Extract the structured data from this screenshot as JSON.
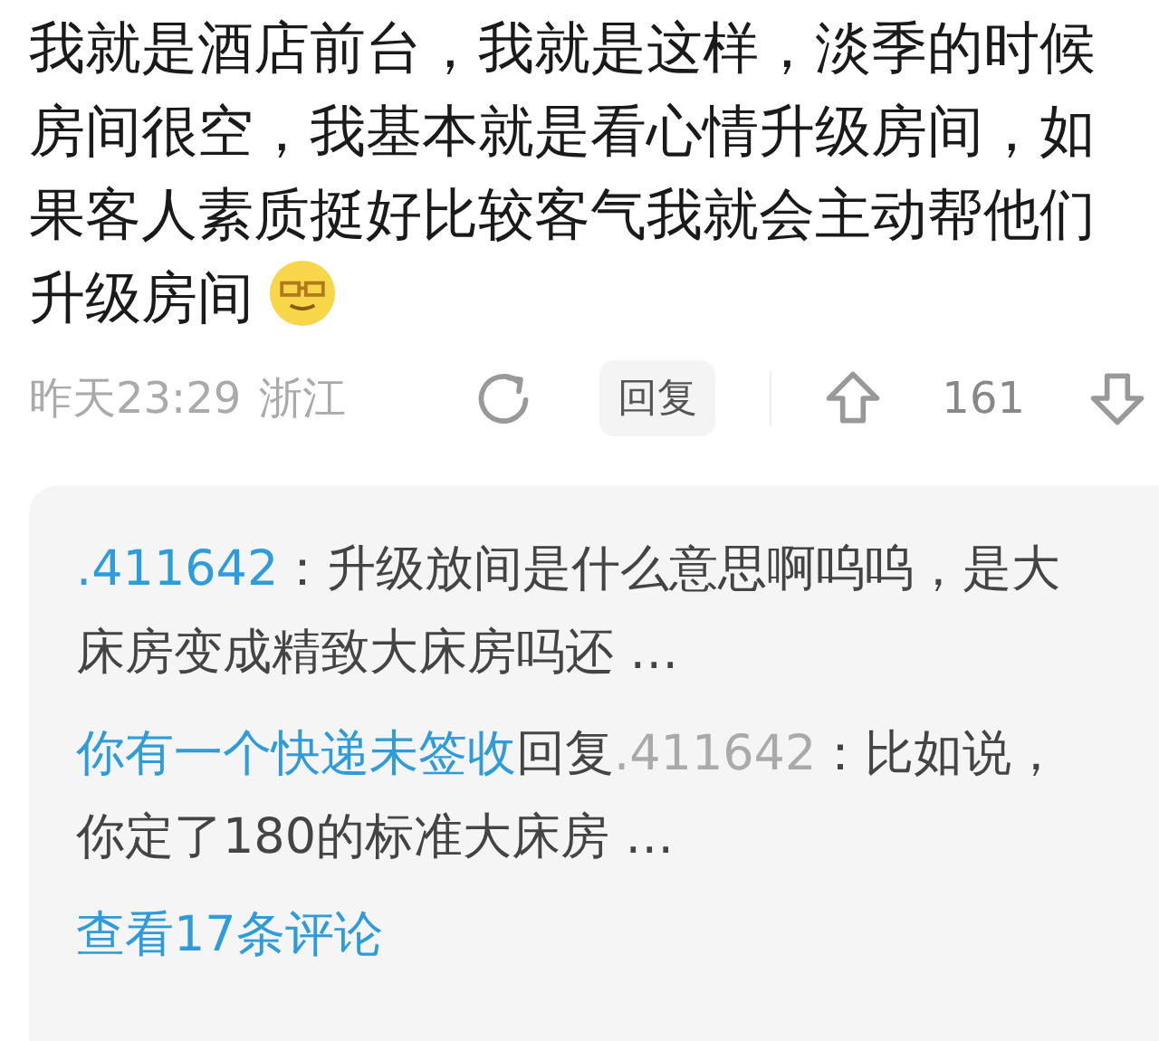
{
  "comment": {
    "text": "我就是酒店前台，我就是这样，淡季的时候房间很空，我基本就是看心情升级房间，如果客人素质挺好比较客气我就会主动帮他们升级房间"
  },
  "meta": {
    "time": "昨天23:29",
    "location": "浙江",
    "reply_label": "回复",
    "votes": "161"
  },
  "replies": [
    {
      "author": ".411642",
      "text": "：升级放间是什么意思啊呜呜，是大床房变成精致大床房吗还 …"
    },
    {
      "author": "你有一个快递未签收",
      "reply_word": "回复",
      "reply_to": ".411642",
      "text": "：比如说，你定了180的标准大床房 …"
    }
  ],
  "view_more": "查看17条评论"
}
